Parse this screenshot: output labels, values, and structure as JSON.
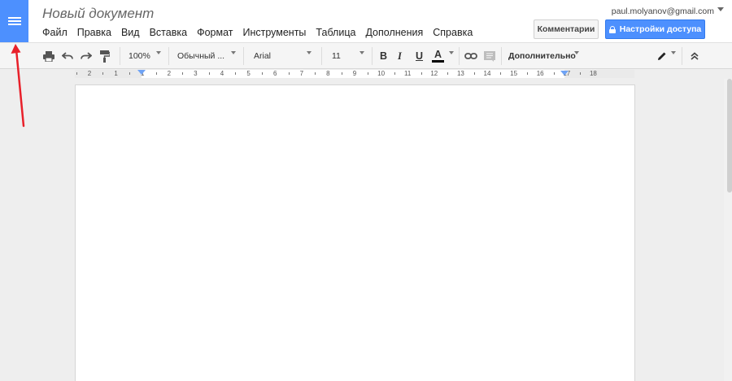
{
  "doc": {
    "title": "Новый документ",
    "account_email": "paul.molyanov@gmail.com"
  },
  "menu": [
    "Файл",
    "Правка",
    "Вид",
    "Вставка",
    "Формат",
    "Инструменты",
    "Таблица",
    "Дополнения",
    "Справка"
  ],
  "buttons": {
    "comments": "Комментарии",
    "share": "Настройки доступа"
  },
  "toolbar": {
    "zoom": "100%",
    "style": "Обычный ...",
    "font": "Arial",
    "size": "11",
    "bold": "B",
    "italic": "I",
    "underline": "U",
    "text_color": "A",
    "more": "Дополнительно"
  },
  "ruler": {
    "labels": [
      "2",
      "1",
      "1",
      "2",
      "3",
      "4",
      "5",
      "6",
      "7",
      "8",
      "9",
      "10",
      "11",
      "12",
      "13",
      "14",
      "15",
      "16",
      "17",
      "18"
    ]
  },
  "icons": {
    "docs_home": "hamburger-menu-icon",
    "print": "print-icon",
    "undo": "undo-icon",
    "redo": "redo-icon",
    "paint_format": "paint-format-icon",
    "link": "link-icon",
    "comment": "comment-icon",
    "edit_mode": "pencil-icon",
    "collapse": "chevron-up-double-icon",
    "share_lock": "lock-icon"
  },
  "colors": {
    "accent": "#4d90fe",
    "annotation": "#e8202a",
    "text_color_bar": "#000000"
  }
}
